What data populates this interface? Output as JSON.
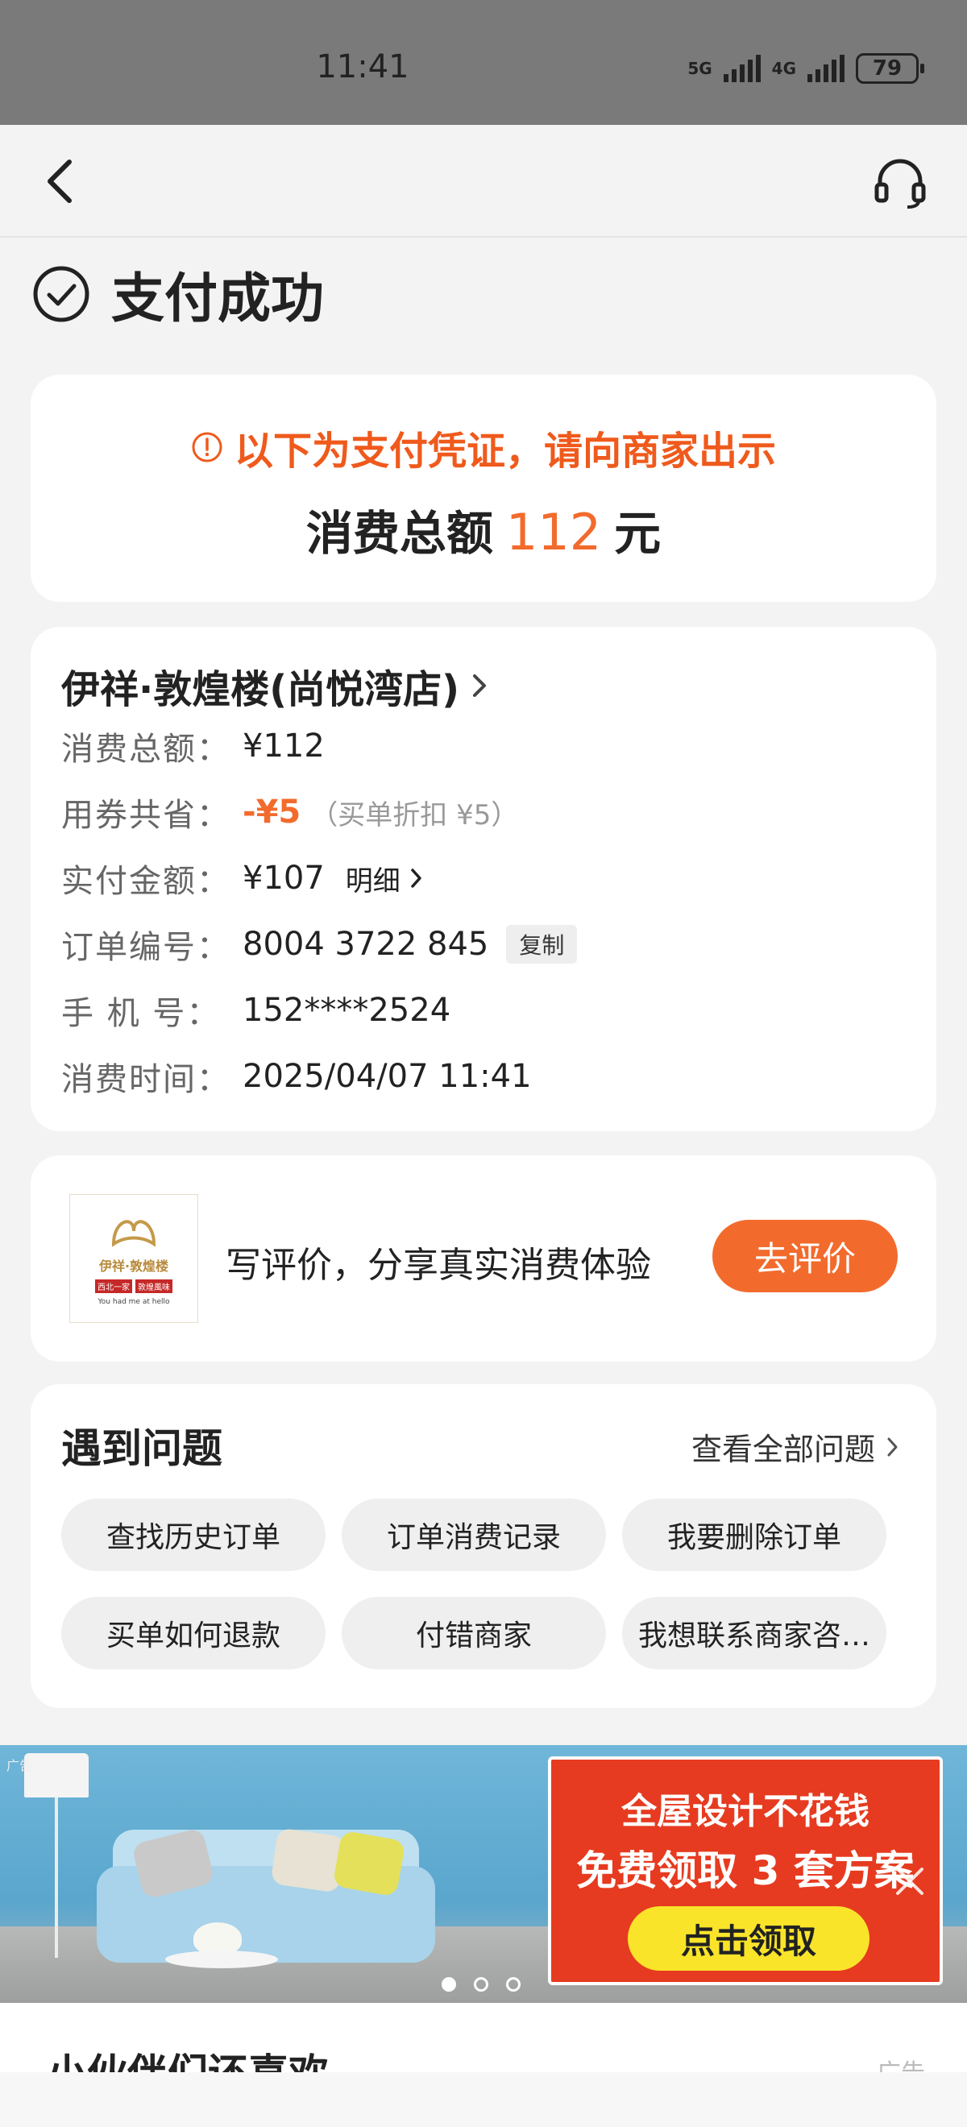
{
  "status_bar": {
    "time": "11:41",
    "signal1": "5G",
    "signal2": "4G",
    "battery": "79"
  },
  "nav": {
    "back_icon": "back-chevron-icon",
    "service_icon": "headset-icon"
  },
  "header": {
    "title": "支付成功"
  },
  "voucher": {
    "notice": "以下为支付凭证，请向商家出示",
    "total_label": "消费总额",
    "total_amount": "112",
    "total_unit": "元"
  },
  "order": {
    "shop_name": "伊祥·敦煌楼(尚悦湾店)",
    "rows": [
      {
        "label": "消费总额：",
        "value": "¥112"
      },
      {
        "label": "用券共省：",
        "value": "-¥5",
        "note": "（买单折扣 ¥5）"
      },
      {
        "label": "实付金额：",
        "value": "¥107",
        "link": "明细"
      },
      {
        "label": "订单编号：",
        "value": "8004 3722 845",
        "action": "复制"
      },
      {
        "label": "手 机 号：",
        "value": "152****2524"
      },
      {
        "label": "消费时间：",
        "value": "2025/04/07 11:41"
      }
    ]
  },
  "review": {
    "logo_name": "伊祥·敦煌楼",
    "logo_tag1": "西北一家",
    "logo_tag2": "敦煌風味",
    "logo_slogan": "You had me at hello",
    "prompt": "写评价，分享真实消费体验",
    "button": "去评价"
  },
  "faq": {
    "title": "遇到问题",
    "view_all": "查看全部问题",
    "chips": [
      "查找历史订单",
      "订单消费记录",
      "我要删除订单",
      "买单如何退款",
      "付错商家",
      "我想联系商家咨…"
    ]
  },
  "banner": {
    "ad_tag": "广告",
    "line1": "全屋设计不花钱",
    "line2": "免费领取 3 套方案",
    "button": "点击领取",
    "slides": 3,
    "active_slide": 1
  },
  "recommend": {
    "title": "小伙伴们还喜欢",
    "ad_label": "广告"
  },
  "colors": {
    "accent": "#f26b2d",
    "notice": "#ef5a1c",
    "background": "#f3f3f3"
  }
}
